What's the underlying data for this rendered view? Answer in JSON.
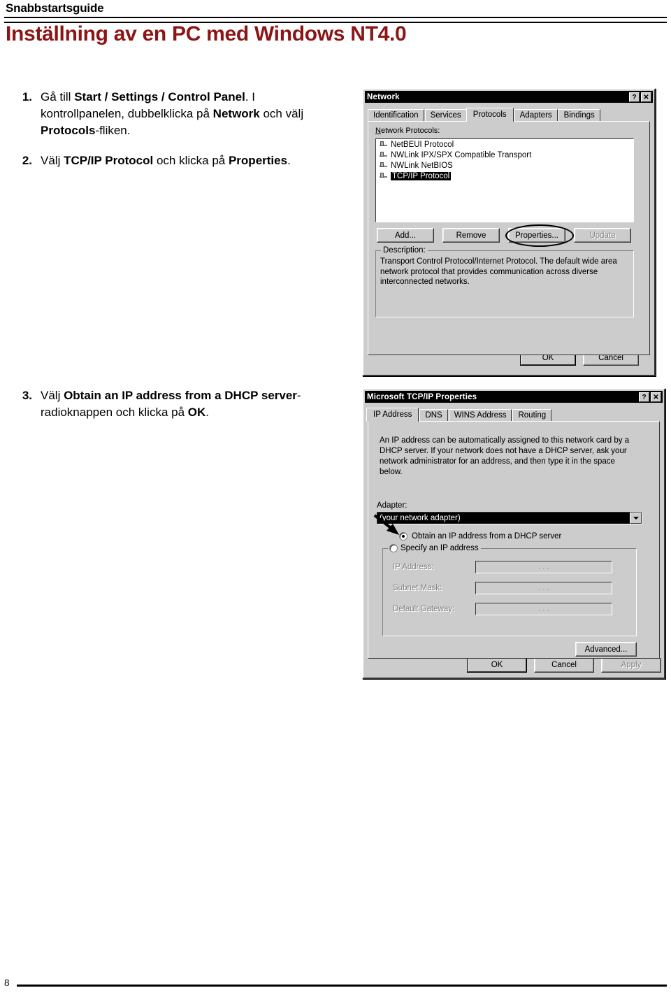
{
  "document": {
    "running_head": "Snabbstartsguide",
    "title": "Inställning av en PC med Windows NT4.0",
    "page_number": "8"
  },
  "steps": [
    {
      "number": "1.",
      "segments": [
        {
          "text": "Gå till ",
          "bold": false
        },
        {
          "text": "Start / Settings / Control Panel",
          "bold": true
        },
        {
          "text": ". I kontrollpanelen, dubbelklicka på ",
          "bold": false
        },
        {
          "text": "Network",
          "bold": true
        },
        {
          "text": " och välj ",
          "bold": false
        },
        {
          "text": "Protocols",
          "bold": true
        },
        {
          "text": "-fliken.",
          "bold": false
        }
      ]
    },
    {
      "number": "2.",
      "segments": [
        {
          "text": "Välj ",
          "bold": false
        },
        {
          "text": "TCP/IP Protocol",
          "bold": true
        },
        {
          "text": " och klicka på ",
          "bold": false
        },
        {
          "text": "Properties",
          "bold": true
        },
        {
          "text": ".",
          "bold": false
        }
      ]
    },
    {
      "number": "3.",
      "segments": [
        {
          "text": "Välj ",
          "bold": false
        },
        {
          "text": "Obtain an IP address from a DHCP server",
          "bold": true
        },
        {
          "text": "-radioknappen och klicka på ",
          "bold": false
        },
        {
          "text": "OK",
          "bold": true
        },
        {
          "text": ".",
          "bold": false
        }
      ]
    }
  ],
  "network_dialog": {
    "title": "Network",
    "titlebar_buttons": [
      {
        "name": "help-icon",
        "glyph": "?"
      },
      {
        "name": "close-icon",
        "glyph": "✕"
      }
    ],
    "tabs": [
      {
        "label": "Identification",
        "active": false
      },
      {
        "label": "Services",
        "active": false
      },
      {
        "label": "Protocols",
        "active": true
      },
      {
        "label": "Adapters",
        "active": false
      },
      {
        "label": "Bindings",
        "active": false
      }
    ],
    "list_label": "Network Protocols:",
    "protocols": [
      {
        "label": "NetBEUI Protocol",
        "selected": false
      },
      {
        "label": "NWLink IPX/SPX Compatible Transport",
        "selected": false
      },
      {
        "label": "NWLink NetBIOS",
        "selected": false
      },
      {
        "label": "TCP/IP Protocol",
        "selected": true
      }
    ],
    "buttons": [
      {
        "label": "Add...",
        "disabled": false,
        "annotated": false
      },
      {
        "label": "Remove",
        "disabled": false,
        "annotated": false
      },
      {
        "label": "Properties...",
        "disabled": false,
        "annotated": true
      },
      {
        "label": "Update",
        "disabled": true,
        "annotated": false
      }
    ],
    "description_label": "Description:",
    "description_text": "Transport Control Protocol/Internet Protocol. The default wide area network protocol that provides communication across diverse interconnected networks.",
    "ok_label": "OK",
    "cancel_label": "Cancel"
  },
  "tcpip_dialog": {
    "title": "Microsoft TCP/IP Properties",
    "titlebar_buttons": [
      {
        "name": "help-icon",
        "glyph": "?"
      },
      {
        "name": "close-icon",
        "glyph": "✕"
      }
    ],
    "tabs": [
      {
        "label": "IP Address",
        "active": true
      },
      {
        "label": "DNS",
        "active": false
      },
      {
        "label": "WINS Address",
        "active": false
      },
      {
        "label": "Routing",
        "active": false
      }
    ],
    "info_text": "An IP address can be automatically assigned to this network card by a DHCP server.  If your network does not have a DHCP server, ask your network administrator for an address, and then type it in the space below.",
    "adapter_label": "Adapter:",
    "adapter_value": "(your network adapter)",
    "radio_dhcp": {
      "label": "Obtain an IP address from a DHCP server",
      "selected": true,
      "annotated": true
    },
    "radio_static": {
      "label": "Specify an IP address",
      "selected": false
    },
    "static_fields": [
      {
        "label": "IP Address:",
        "value": ".    .    ."
      },
      {
        "label": "Subnet Mask:",
        "value": ".    .    ."
      },
      {
        "label": "Default Gateway:",
        "value": ".    .    ."
      }
    ],
    "advanced_label": "Advanced...",
    "ok_label": "OK",
    "cancel_label": "Cancel",
    "apply_label": "Apply"
  },
  "colors": {
    "title_red": "#8c1515",
    "win_face": "#c0c0c0",
    "win_titlebar": "#000080",
    "selection": "#000080"
  }
}
